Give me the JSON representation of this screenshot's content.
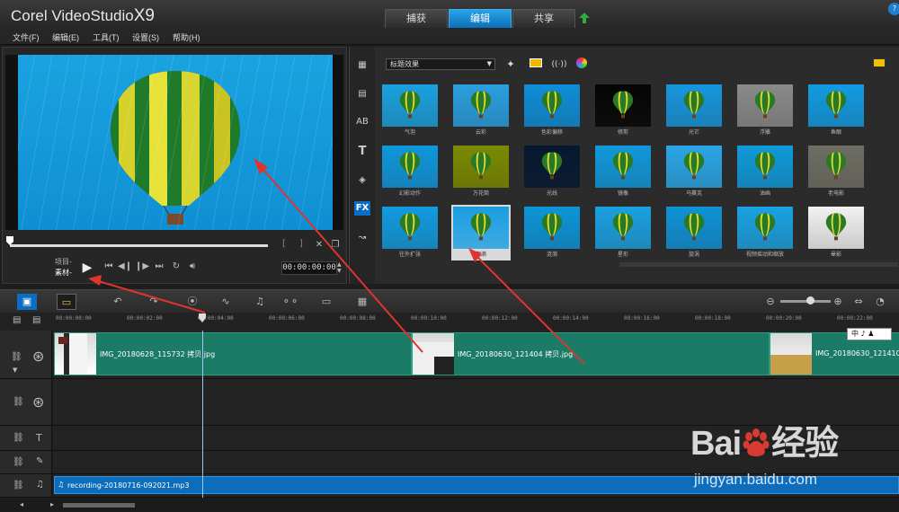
{
  "app": {
    "brand_prefix": "Corel",
    "brand_name": "VideoStudio",
    "brand_version": "X9",
    "help": "?"
  },
  "steps": [
    {
      "label": "捕获"
    },
    {
      "label": "编辑"
    },
    {
      "label": "共享"
    }
  ],
  "menu": [
    "文件(F)",
    "编辑(E)",
    "工具(T)",
    "设置(S)",
    "帮助(H)"
  ],
  "player": {
    "mode_project": "项目-",
    "mode_clip": "素材-",
    "timecode": "00:00:00:00",
    "mark_in": "[",
    "mark_out": "]"
  },
  "library": {
    "dropdown": "标题效果",
    "filters": [
      {
        "label": "气泡",
        "color": "#1aa1df"
      },
      {
        "label": "云彩",
        "color": "#2a9fe0"
      },
      {
        "label": "色彩偏移",
        "color": "#0d8ed8"
      },
      {
        "label": "修剪",
        "color": "#050505"
      },
      {
        "label": "光芒",
        "color": "#1696dd"
      },
      {
        "label": "浮雕",
        "color": "#8a8a8a"
      },
      {
        "label": "鱼眼",
        "color": "#119be2"
      },
      {
        "label": "幻影动作",
        "color": "#0f97dd"
      },
      {
        "label": "万花筒",
        "color": "#7a8a00"
      },
      {
        "label": "光线",
        "color": "#061830"
      },
      {
        "label": "镜像",
        "color": "#1098dc"
      },
      {
        "label": "马赛克",
        "color": "#2aa6e6"
      },
      {
        "label": "油画",
        "color": "#0f9ada"
      },
      {
        "label": "老电影",
        "color": "#6e6e64"
      },
      {
        "label": "往外扩张",
        "color": "#119bdf"
      },
      {
        "label": "雨滴",
        "color": "#1a9ee2"
      },
      {
        "label": "涟漪",
        "color": "#0c95d8"
      },
      {
        "label": "星形",
        "color": "#1aa0e0"
      },
      {
        "label": "旋涡",
        "color": "#0e93d6"
      },
      {
        "label": "视频摇动和缩放",
        "color": "#1aa2e2"
      },
      {
        "label": "晕影",
        "color": "#f2f2f2"
      }
    ],
    "selected": "雨滴"
  },
  "ruler": [
    "00:00:00:00",
    "00:00:02:00",
    "00:00:04:00",
    "00:00:06:00",
    "00:00:08:00",
    "00:00:10:00",
    "00:00:12:00",
    "00:00:14:00",
    "00:00:16:00",
    "00:00:18:00",
    "00:00:20:00",
    "00:00:22:00"
  ],
  "timeline": {
    "video_clips": [
      "IMG_20180628_115732 拷贝.jpg",
      "IMG_20180630_121404 拷贝.jpg",
      "IMG_20180630_121410"
    ],
    "audio_clip": "recording-20180716-092021.mp3",
    "ime": "中 ♪ ♟"
  },
  "watermark": {
    "logo_a": "Bai",
    "logo_b": "经验",
    "url": "jingyan.baidu.com"
  },
  "colors": {
    "accent": "#0b6ec4",
    "clip": "#1b7b66",
    "audio": "#0c6dbd",
    "arrow": "#e0342e"
  }
}
